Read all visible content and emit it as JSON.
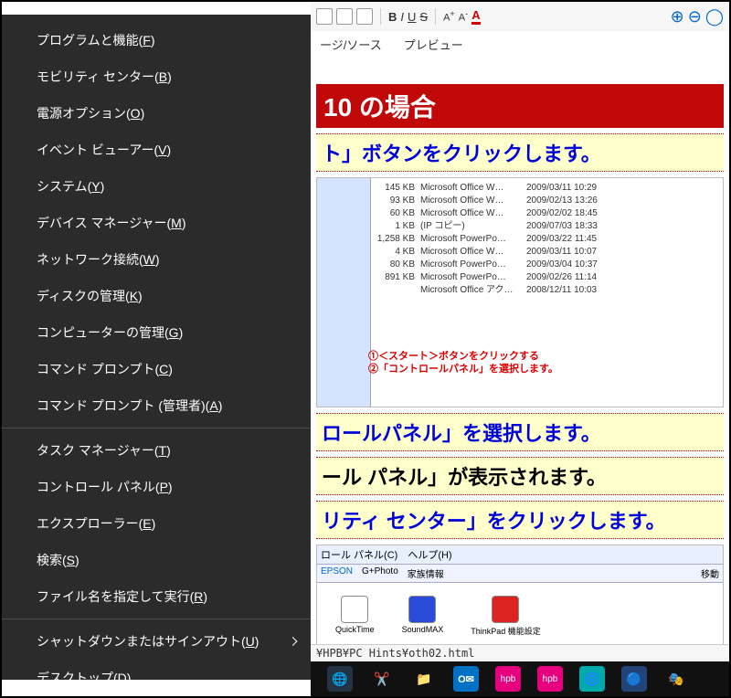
{
  "menu": {
    "group1": [
      {
        "label": "プログラムと機能(",
        "accel": "F",
        "tail": ")"
      },
      {
        "label": "モビリティ センター(",
        "accel": "B",
        "tail": ")"
      },
      {
        "label": "電源オプション(",
        "accel": "O",
        "tail": ")"
      },
      {
        "label": "イベント ビューアー(",
        "accel": "V",
        "tail": ")"
      },
      {
        "label": "システム(",
        "accel": "Y",
        "tail": ")"
      },
      {
        "label": "デバイス マネージャー(",
        "accel": "M",
        "tail": ")"
      },
      {
        "label": "ネットワーク接続(",
        "accel": "W",
        "tail": ")"
      },
      {
        "label": "ディスクの管理(",
        "accel": "K",
        "tail": ")"
      },
      {
        "label": "コンピューターの管理(",
        "accel": "G",
        "tail": ")"
      },
      {
        "label": "コマンド プロンプト(",
        "accel": "C",
        "tail": ")"
      },
      {
        "label": "コマンド プロンプト (管理者)(",
        "accel": "A",
        "tail": ")"
      }
    ],
    "group2": [
      {
        "label": "タスク マネージャー(",
        "accel": "T",
        "tail": ")"
      },
      {
        "label": "コントロール パネル(",
        "accel": "P",
        "tail": ")",
        "highlighted": true
      },
      {
        "label": "エクスプローラー(",
        "accel": "E",
        "tail": ")"
      },
      {
        "label": "検索(",
        "accel": "S",
        "tail": ")"
      },
      {
        "label": "ファイル名を指定して実行(",
        "accel": "R",
        "tail": ")"
      }
    ],
    "group3": [
      {
        "label": "シャットダウンまたはサインアウト(",
        "accel": "U",
        "tail": ")",
        "hasarrow": true
      },
      {
        "label": "デスクトップ(",
        "accel": "D",
        "tail": ")"
      }
    ]
  },
  "toolbar": {
    "bold": "B",
    "italic": "I",
    "underline": "U",
    "strike": "S"
  },
  "tabs": {
    "t1": "ージ/ソース",
    "t2": "プレビュー"
  },
  "doc": {
    "banner": "10 の場合",
    "step1": "ト」ボタンをクリックします。",
    "cap1": "①＜スタート＞ボタンをクリックする",
    "cap2": "②「コントロールパネル」を選択します。",
    "step2": "ロールパネル」を選択します。",
    "step3": "ール パネル」が表示されます。",
    "step4": "リティ センター」をクリックします。",
    "iconlabels": {
      "a": "QuickTime",
      "b": "SoundMAX",
      "c": "ThinkPad 機能設定"
    },
    "filelist": [
      {
        "size": "145 KB",
        "type": "Microsoft Office W…",
        "date": "2009/03/11 10:29"
      },
      {
        "size": "93 KB",
        "type": "Microsoft Office W…",
        "date": "2009/02/13 13:26"
      },
      {
        "size": "60 KB",
        "type": "Microsoft Office W…",
        "date": "2009/02/02 18:45"
      },
      {
        "size": "1 KB",
        "type": "(IP コピー)",
        "date": "2009/07/03 18:33"
      },
      {
        "size": "1,258 KB",
        "type": "Microsoft PowerPo…",
        "date": "2009/03/22 11:45"
      },
      {
        "size": "4 KB",
        "type": "Microsoft Office W…",
        "date": "2009/03/11 10:07"
      },
      {
        "size": "80 KB",
        "type": "Microsoft PowerPo…",
        "date": "2009/03/04 10:37"
      },
      {
        "size": "891 KB",
        "type": "Microsoft PowerPo…",
        "date": "2009/02/26 11:14"
      },
      {
        "size": "",
        "type": "Microsoft Office アク…",
        "date": "2008/12/11 10:03"
      }
    ]
  },
  "status": "¥HPB¥PC Hints¥oth02.html",
  "taskbar": {
    "items": [
      "globe",
      "scissors",
      "folder",
      "outlook",
      "hpb",
      "hpb",
      "teal",
      "blue",
      "mascot"
    ]
  },
  "colors": {
    "accent": "#c00808",
    "highlight": "#e01030"
  }
}
